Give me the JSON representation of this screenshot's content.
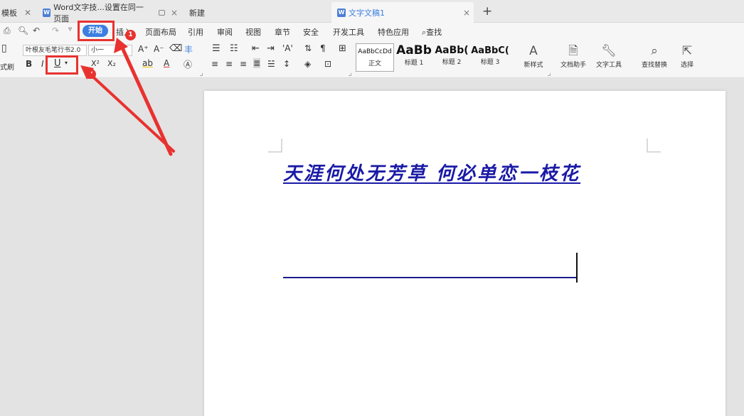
{
  "tabs": [
    {
      "label": "模板",
      "close": "✕"
    },
    {
      "label": "Word文字技...设置在同一页面",
      "close": "×"
    },
    {
      "label": "新建"
    },
    {
      "label": "文字文稿1",
      "close": "×"
    }
  ],
  "tab_doc_icon": "W",
  "new_tab": "+",
  "menu": {
    "start": "开始",
    "items": [
      "插入",
      "页面布局",
      "引用",
      "审阅",
      "视图",
      "章节",
      "安全",
      "开发工具",
      "特色应用",
      "查找"
    ]
  },
  "ribbon": {
    "font_name": "叶根友毛笔行书2.0",
    "font_size": "小一",
    "format_brush": "式刷",
    "bold": "B",
    "italic": "I",
    "underline": "U",
    "superscript": "X²",
    "subscript": "X₂",
    "styles": [
      {
        "preview": "AaBbCcDd",
        "label": "正文"
      },
      {
        "preview": "AaBb",
        "label": "标题 1"
      },
      {
        "preview": "AaBb(",
        "label": "标题 2"
      },
      {
        "preview": "AaBbC(",
        "label": "标题 3"
      }
    ],
    "new_style": "新样式",
    "doc_helper": "文档助手",
    "text_tools": "文字工具",
    "find_replace": "查找替换",
    "select": "选择"
  },
  "badges": [
    "1",
    "2"
  ],
  "document": {
    "heading": "天涯何处无芳草 何必单恋一枝花"
  },
  "colors": {
    "accent": "#3c7fe0",
    "highlight": "#e8322f",
    "heading_text": "#1a1aa6"
  }
}
